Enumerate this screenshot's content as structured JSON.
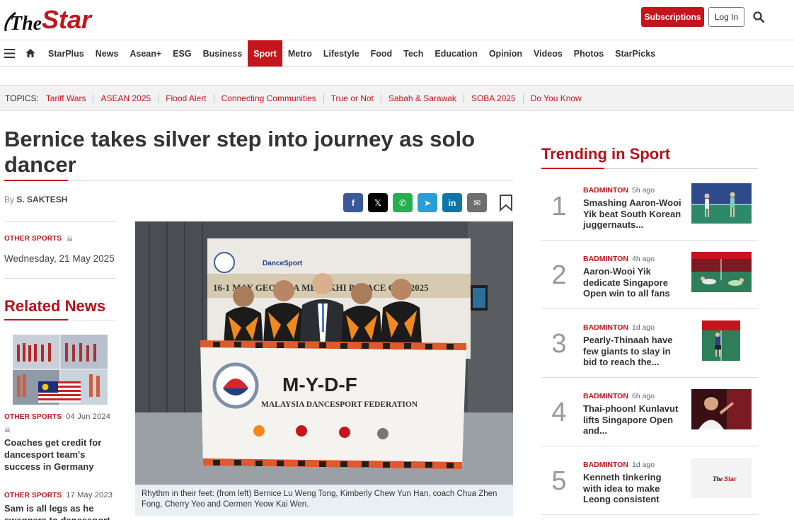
{
  "brand": {
    "logo_text": "The Star",
    "accent": "#c4151c"
  },
  "header": {
    "subscribe_label": "Subscriptions",
    "login_label": "Log In",
    "search_icon": "search-icon"
  },
  "nav": {
    "items": [
      "StarPlus",
      "News",
      "Asean+",
      "ESG",
      "Business",
      "Sport",
      "Metro",
      "Lifestyle",
      "Food",
      "Tech",
      "Education",
      "Opinion",
      "Videos",
      "Photos",
      "StarPicks"
    ],
    "active": "Sport"
  },
  "topics": {
    "label": "TOPICS:",
    "items": [
      "Tariff Wars",
      "ASEAN 2025",
      "Flood Alert",
      "Connecting Communities",
      "True or Not",
      "Sabah & Sarawak",
      "SOBA 2025",
      "Do You Know"
    ]
  },
  "article": {
    "title": "Bernice takes silver step into journey as solo dancer",
    "by": "By",
    "author": "S. SAKTESH",
    "category": "OTHER SPORTS",
    "date": "Wednesday, 21 May 2025",
    "caption": "Rhythm in their feet: (from left) Bernice Lu Weng Tong, Kimberly Chew Yun Han, coach Chua Zhen Fong, Cherry Yeo and Cermen Yeow Kai Wen.",
    "photo_banner": {
      "brand": "M-Y-D-F",
      "name": "MALAYSIA DANCESPORT FEDERATION",
      "backdrop": "16-1 MAY GEORGIA METEKHI PALACE CUP-2025"
    }
  },
  "share": {
    "facebook": "f",
    "x": "𝕏",
    "whatsapp": "✆",
    "telegram": "➤",
    "linkedin": "in",
    "email": "✉"
  },
  "related": {
    "title": "Related News",
    "items": [
      {
        "category": "OTHER SPORTS",
        "ago": "04 Jun 2024",
        "title": "Coaches get credit for dancesport team's success in Germany"
      },
      {
        "category": "OTHER SPORTS",
        "ago": "17 May 2023",
        "title": "Sam is all legs as he swaggers to dancesport"
      }
    ]
  },
  "trending": {
    "title": "Trending in Sport",
    "items": [
      {
        "num": "1",
        "category": "BADMINTON",
        "ago": "5h ago",
        "title": "Smashing Aaron-Wooi Yik beat South Korean juggernauts..."
      },
      {
        "num": "2",
        "category": "BADMINTON",
        "ago": "4h ago",
        "title": "Aaron-Wooi Yik dedicate Singapore Open win to all fans"
      },
      {
        "num": "3",
        "category": "BADMINTON",
        "ago": "1d ago",
        "title": "Pearly-Thinaah have few giants to slay in bid to reach the..."
      },
      {
        "num": "4",
        "category": "BADMINTON",
        "ago": "6h ago",
        "title": "Thai-phoon! Kunlavut lifts Singapore Open and..."
      },
      {
        "num": "5",
        "category": "BADMINTON",
        "ago": "1d ago",
        "title": "Kenneth tinkering with idea to make Leong consistent"
      }
    ]
  }
}
